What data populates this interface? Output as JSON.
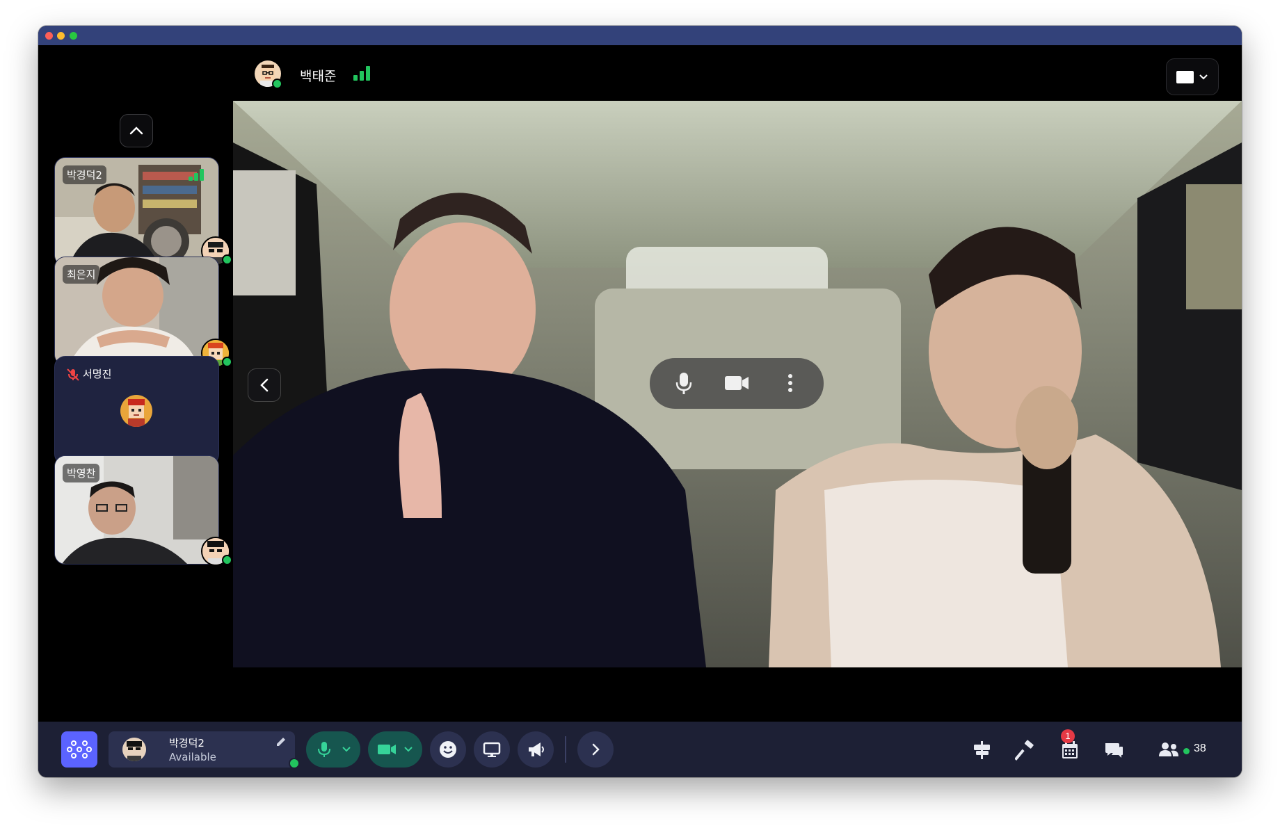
{
  "header": {
    "speaker_name": "백태준",
    "signal_icon": "signal-bars-icon",
    "layout_icon": "screen-layout-icon"
  },
  "sidebar": {
    "tiles": [
      {
        "name": "박경덕2",
        "video": true,
        "muted": false
      },
      {
        "name": "최은지",
        "video": true,
        "muted": false
      },
      {
        "name": "서명진",
        "video": false,
        "muted": true
      },
      {
        "name": "박영찬",
        "video": true,
        "muted": false
      }
    ]
  },
  "video_controls": [
    "microphone-icon",
    "camera-icon",
    "more-vertical-icon"
  ],
  "bottom": {
    "user_name": "박경덕2",
    "user_status": "Available",
    "chat_badge": "1",
    "participant_count": "38"
  },
  "colors": {
    "titlebar": "#33427a",
    "bottombar": "#1d2035",
    "accent": "#5b63ff",
    "green": "#22c55e",
    "media_pill": "#16564f",
    "badge": "#e53945"
  }
}
